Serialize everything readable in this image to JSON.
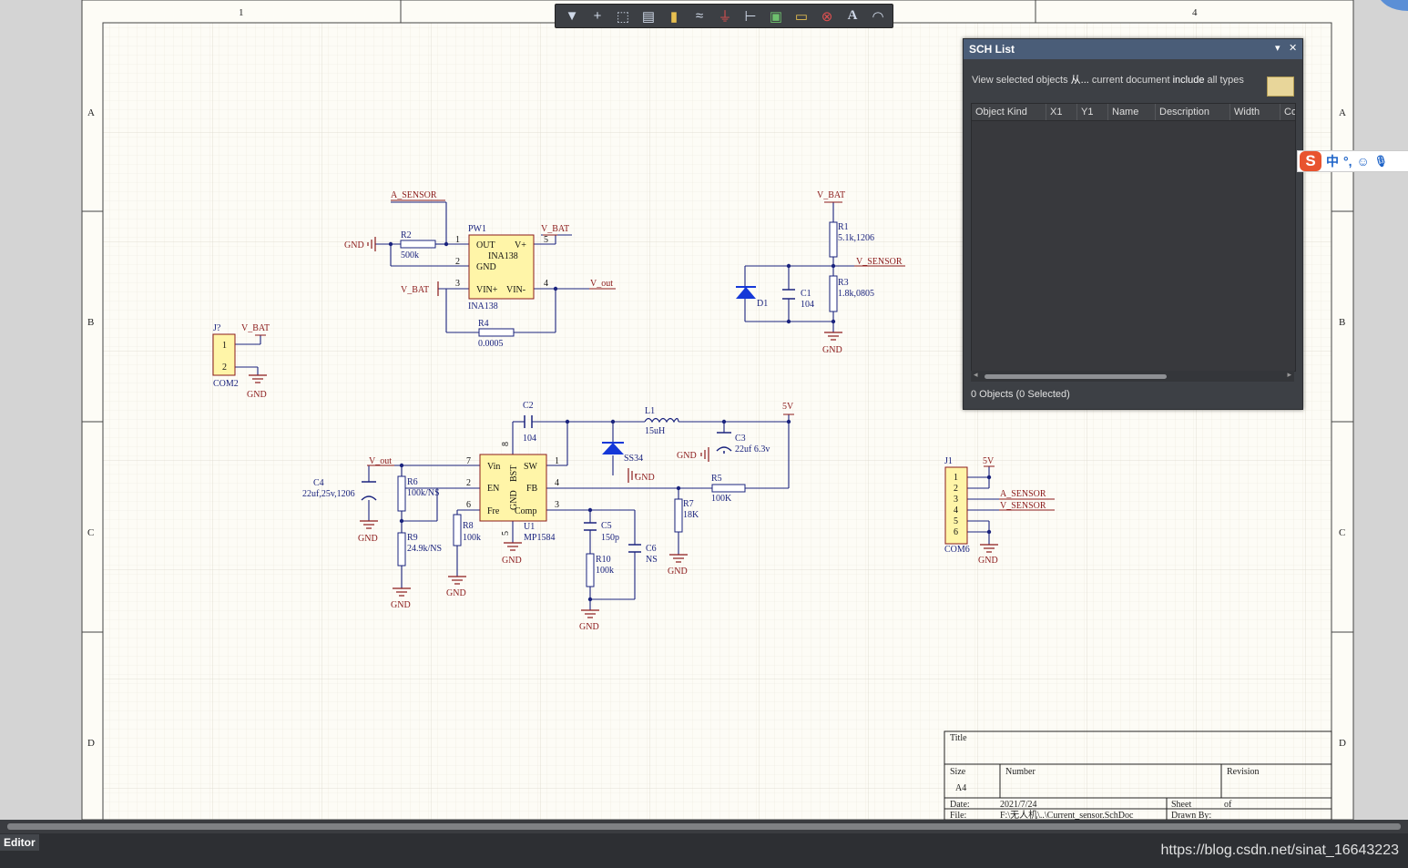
{
  "toolbar": {
    "icons": [
      "filter-icon",
      "cross-icon",
      "select-rect-icon",
      "align-icon",
      "part-icon",
      "bus-icon",
      "power-icon",
      "wire-icon",
      "harness-icon",
      "port-icon",
      "no-erc-icon",
      "text-icon",
      "arc-icon"
    ],
    "text_glyph": "A"
  },
  "sheet": {
    "col_labels": [
      "1",
      "4"
    ],
    "row_labels": [
      "A",
      "B",
      "C",
      "D"
    ],
    "title_block": {
      "title_label": "Title",
      "size_label": "Size",
      "size_value": "A4",
      "number_label": "Number",
      "revision_label": "Revision",
      "date_label": "Date:",
      "date_value": "2021/7/24",
      "sheet_label": "Sheet",
      "of_label": "of",
      "file_label": "File:",
      "file_value": "F:\\无人机\\..\\Current_sensor.SchDoc",
      "drawn_label": "Drawn By:"
    }
  },
  "schematic": {
    "labels": [
      {
        "id": "a_sensor_1",
        "text": "A_SENSOR"
      },
      {
        "id": "gnd_r2",
        "text": "GND"
      },
      {
        "id": "r2",
        "text": "R2"
      },
      {
        "id": "r2v",
        "text": "500k"
      },
      {
        "id": "pw1",
        "text": "PW1"
      },
      {
        "id": "vbat_pw1",
        "text": "V_BAT"
      },
      {
        "id": "out",
        "text": "OUT"
      },
      {
        "id": "vplus",
        "text": "V+"
      },
      {
        "id": "ina138a",
        "text": "INA138"
      },
      {
        "id": "gndpin",
        "text": "GND"
      },
      {
        "id": "vinp",
        "text": "VIN+"
      },
      {
        "id": "vinm",
        "text": "VIN-"
      },
      {
        "id": "ina138b",
        "text": "INA138"
      },
      {
        "id": "vbat_in",
        "text": "V_BAT"
      },
      {
        "id": "vout1",
        "text": "V_out"
      },
      {
        "id": "r4",
        "text": "R4"
      },
      {
        "id": "r4v",
        "text": "0.0005"
      },
      {
        "id": "p1",
        "text": "1"
      },
      {
        "id": "p2",
        "text": "2"
      },
      {
        "id": "p3",
        "text": "3"
      },
      {
        "id": "p4",
        "text": "4"
      },
      {
        "id": "p5",
        "text": "5"
      },
      {
        "id": "vbat_r1",
        "text": "V_BAT"
      },
      {
        "id": "r1",
        "text": "R1"
      },
      {
        "id": "r1v",
        "text": "5.1k,1206"
      },
      {
        "id": "vsensor",
        "text": "V_SENSOR"
      },
      {
        "id": "r3",
        "text": "R3"
      },
      {
        "id": "r3v",
        "text": "1.8k,0805"
      },
      {
        "id": "d1",
        "text": "D1"
      },
      {
        "id": "c1",
        "text": "C1"
      },
      {
        "id": "c1v",
        "text": "104"
      },
      {
        "id": "gnd_c1",
        "text": "GND"
      },
      {
        "id": "j7",
        "text": "J?"
      },
      {
        "id": "vbat_j",
        "text": "V_BAT"
      },
      {
        "id": "j1p1",
        "text": "1"
      },
      {
        "id": "j1p2",
        "text": "2"
      },
      {
        "id": "com2",
        "text": "COM2"
      },
      {
        "id": "gnd_j",
        "text": "GND"
      },
      {
        "id": "c2",
        "text": "C2"
      },
      {
        "id": "c2v",
        "text": "104"
      },
      {
        "id": "l1",
        "text": "L1"
      },
      {
        "id": "l1v",
        "text": "15uH"
      },
      {
        "id": "v5",
        "text": "5V"
      },
      {
        "id": "c3",
        "text": "C3"
      },
      {
        "id": "c3v",
        "text": "22uf 6.3v"
      },
      {
        "id": "gnd_c3",
        "text": "GND"
      },
      {
        "id": "ss34",
        "text": "SS34"
      },
      {
        "id": "gnd_ss",
        "text": "GND"
      },
      {
        "id": "vout2",
        "text": "V_out"
      },
      {
        "id": "c4",
        "text": "C4"
      },
      {
        "id": "c4v",
        "text": "22uf,25v,1206"
      },
      {
        "id": "gnd_c4",
        "text": "GND"
      },
      {
        "id": "r6",
        "text": "R6"
      },
      {
        "id": "r6v",
        "text": "100k/NS"
      },
      {
        "id": "r9",
        "text": "R9"
      },
      {
        "id": "r9v",
        "text": "24.9k/NS"
      },
      {
        "id": "gnd_r9",
        "text": "GND"
      },
      {
        "id": "r8",
        "text": "R8"
      },
      {
        "id": "r8v",
        "text": "100k"
      },
      {
        "id": "gnd_r8",
        "text": "GND"
      },
      {
        "id": "vin",
        "text": "Vin"
      },
      {
        "id": "en",
        "text": "EN"
      },
      {
        "id": "fre",
        "text": "Fre"
      },
      {
        "id": "bst",
        "text": "BST"
      },
      {
        "id": "gndv",
        "text": "GND"
      },
      {
        "id": "sw",
        "text": "SW"
      },
      {
        "id": "fb",
        "text": "FB"
      },
      {
        "id": "comp",
        "text": "Comp"
      },
      {
        "id": "u7",
        "text": "7"
      },
      {
        "id": "u2",
        "text": "2"
      },
      {
        "id": "u6",
        "text": "6"
      },
      {
        "id": "u8",
        "text": "8"
      },
      {
        "id": "u1p",
        "text": "1"
      },
      {
        "id": "u4",
        "text": "4"
      },
      {
        "id": "u3",
        "text": "3"
      },
      {
        "id": "u5",
        "text": "5"
      },
      {
        "id": "u1",
        "text": "U1"
      },
      {
        "id": "mp1584",
        "text": "MP1584"
      },
      {
        "id": "gnd_u1",
        "text": "GND"
      },
      {
        "id": "c5",
        "text": "C5"
      },
      {
        "id": "c5v",
        "text": "150p"
      },
      {
        "id": "r10",
        "text": "R10"
      },
      {
        "id": "r10v",
        "text": "100k"
      },
      {
        "id": "c6",
        "text": "C6"
      },
      {
        "id": "c6v",
        "text": "NS"
      },
      {
        "id": "gnd_c5",
        "text": "GND"
      },
      {
        "id": "r7",
        "text": "R7"
      },
      {
        "id": "r7v",
        "text": "18K"
      },
      {
        "id": "gnd_r7",
        "text": "GND"
      },
      {
        "id": "r5",
        "text": "R5"
      },
      {
        "id": "r5v",
        "text": "100K"
      },
      {
        "id": "j1",
        "text": "J1"
      },
      {
        "id": "v5b",
        "text": "5V"
      },
      {
        "id": "asens2",
        "text": "A_SENSOR"
      },
      {
        "id": "vsens2",
        "text": "V_SENSOR"
      },
      {
        "id": "com6",
        "text": "COM6"
      },
      {
        "id": "gnd_j1",
        "text": "GND"
      },
      {
        "id": "jp1",
        "text": "1"
      },
      {
        "id": "jp2",
        "text": "2"
      },
      {
        "id": "jp3",
        "text": "3"
      },
      {
        "id": "jp4",
        "text": "4"
      },
      {
        "id": "jp5",
        "text": "5"
      },
      {
        "id": "jp6",
        "text": "6"
      }
    ]
  },
  "sch_list": {
    "title": "SCH List",
    "desc_1": "View",
    "desc_2": "selected objects",
    "desc_3": "从...",
    "desc_4": "current document",
    "desc_5": "include",
    "desc_6": "all types",
    "columns": [
      "Object Kind",
      "X1",
      "Y1",
      "Name",
      "Description",
      "Width",
      "Co"
    ],
    "status": "0 Objects (0 Selected)"
  },
  "ime": {
    "logo": "S",
    "mode": "中",
    "punct": "°,",
    "emoji": "☺",
    "mic": "🎤"
  },
  "bottom": {
    "tab": "Editor",
    "watermark": "https://blog.csdn.net/sinat_16643223"
  }
}
